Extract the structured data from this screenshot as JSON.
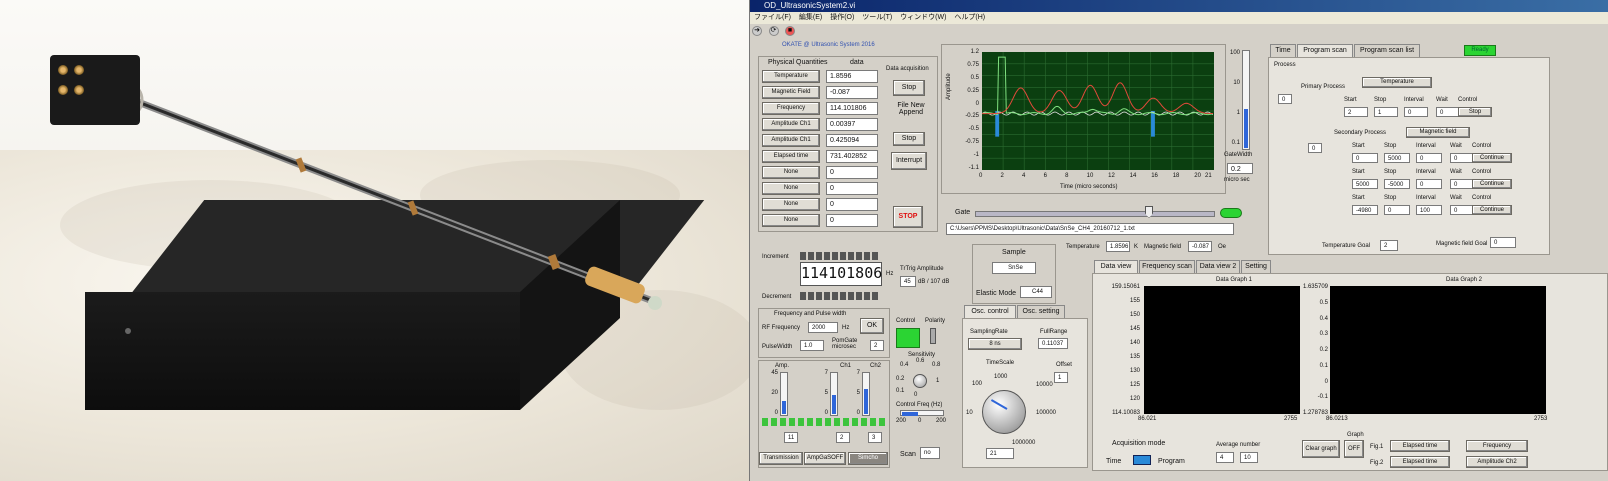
{
  "window": {
    "title": "OD_UltrasonicSystem2.vi",
    "menu": [
      "ファイル(F)",
      "編集(E)",
      "操作(O)",
      "ツール(T)",
      "ウィンドウ(W)",
      "ヘルプ(H)"
    ],
    "banner": "OKATE @ Ultrasonic System 2016",
    "status": "Ready"
  },
  "physical": {
    "header_qty": "Physical Quantities",
    "header_data": "data",
    "rows": [
      {
        "label": "Temperature",
        "value": "1.8596"
      },
      {
        "label": "Magnetic Field",
        "value": "-0.087"
      },
      {
        "label": "Frequency",
        "value": "114.101806"
      },
      {
        "label": "Amplitude Ch1",
        "value": "0.00397"
      },
      {
        "label": "Amplitude Ch1",
        "value": "0.425094"
      },
      {
        "label": "Elapsed time",
        "value": "731.402852"
      },
      {
        "label": "None",
        "value": "0"
      },
      {
        "label": "None",
        "value": "0"
      },
      {
        "label": "None",
        "value": "0"
      },
      {
        "label": "None",
        "value": "0"
      }
    ]
  },
  "acq": {
    "data_acq": "Data acquisition",
    "stop": "Stop",
    "file_append": "File New Append",
    "stop2": "Stop",
    "interrupt": "Interrupt",
    "stop_red": "STOP"
  },
  "osc": {
    "y_ticks": [
      "1.2",
      "0.75",
      "0.5",
      "0.25",
      "0",
      "-0.25",
      "-0.5",
      "-0.75",
      "-1",
      "-1.1"
    ],
    "x_ticks": [
      "0",
      "2",
      "4",
      "6",
      "8",
      "10",
      "12",
      "14",
      "16",
      "18",
      "20",
      "21"
    ],
    "xlabel": "Time (micro seconds)",
    "ylabel": "Amplitude",
    "gatewidth_label": "GateWidth",
    "gatewidth_value": "0.2",
    "gatewidth_unit": "micro sec",
    "bar_ticks": [
      "100",
      "10",
      "1",
      "0.1"
    ],
    "gate_label": "Gate",
    "path": "C:\\Users\\PPMS\\Desktop\\Ultrasonic\\Data\\SnSe_CH4_20160712_1.txt"
  },
  "readout": {
    "temperature_label": "Temperature",
    "temperature": "1.8596",
    "temperature_unit": "K",
    "field_label": "Magnetic field",
    "field": "-0.087",
    "field_unit": "Oe"
  },
  "freq": {
    "increment": "Increment",
    "decrement": "Decrement",
    "display": "114101806",
    "unit": "Hz",
    "trig_label": "TrTrig Amplitude",
    "trig_value": "45",
    "trig_unit": "dB / 107 dB",
    "section_title": "Frequency and Pulse width",
    "rf_label": "RF Frequency",
    "rf_value": "2000",
    "rf_unit": "Hz",
    "ok": "OK",
    "pw_label": "PulseWidth",
    "pw_value": "1.0",
    "pgate_label": "PomGate microsec",
    "pgate_value": "2"
  },
  "sample": {
    "title": "Sample",
    "name": "SnSe",
    "elastic_label": "Elastic Mode",
    "elastic_value": "C44"
  },
  "control": {
    "control_label": "Control",
    "polarity_label": "Polarity",
    "sensitivity_label": "Sensitivity",
    "sens_ticks": [
      "0.4",
      "0.6",
      "0.8",
      "0.2",
      "1",
      "0.1",
      "0"
    ],
    "cfreq_label": "Control Freq (Hz)",
    "cfreq_ticks": [
      "200",
      "0",
      "200"
    ],
    "scan_label": "Scan",
    "scan_value": "no"
  },
  "amp": {
    "amp_label": "Amp.",
    "ch1_label": "Ch1",
    "ch2_label": "Ch2",
    "amp_ticks": [
      "45",
      "20",
      "0"
    ],
    "ch_ticks": [
      "7",
      "5",
      "0"
    ],
    "amp_value": "11",
    "ch1_value": "2",
    "ch2_value": "3",
    "amp_level": 0.3,
    "ch1_level": 0.45,
    "ch2_level": 0.6,
    "b1": "Transmission",
    "b2": "AmpGaSOFF",
    "b3": "Simcho"
  },
  "osc_tabs": {
    "tab1": "Osc. control",
    "tab2": "Osc. setting",
    "sampling_label": "SamplingRate",
    "sampling_value": "8 ns",
    "fullrange_label": "FullRange",
    "fullrange_value": "0.11037",
    "timescale_label": "TimeScale",
    "ts_ticks": [
      "100",
      "1000",
      "10000",
      "1000000",
      "10",
      "100000"
    ],
    "offset_label": "Offset",
    "offset_value": "1",
    "timescale_value": "21"
  },
  "acq_mode": {
    "label": "Acquisition mode",
    "time": "Time",
    "program": "Program",
    "avg_label": "Average number",
    "avg_a": "4",
    "avg_b": "10"
  },
  "right_tabs": {
    "tab1": "Time",
    "tab2": "Program scan",
    "tab3": "Program scan list",
    "process": "Process",
    "primary_label": "Primary Process",
    "primary_value": "Temperature",
    "secondary_label": "Secondary Process",
    "secondary_value": "Magnetic field",
    "col_start": "Start",
    "col_stop": "Stop",
    "col_interval": "Interval",
    "col_wait": "Wait",
    "col_control": "Control",
    "p_idx": "0",
    "p_row": [
      "2",
      "1",
      "0",
      "0",
      "Stop"
    ],
    "s_idx": "0",
    "s_rows": [
      [
        "0",
        "5000",
        "0",
        "0",
        "Continue"
      ],
      [
        "5000",
        "-5000",
        "0",
        "0",
        "Continue"
      ],
      [
        "-4980",
        "0",
        "100",
        "0",
        "Continue"
      ]
    ],
    "tgoal_label": "Temperature Goal",
    "tgoal_value": "2",
    "mgoal_label": "Magnetic field Goal",
    "mgoal_value": "0"
  },
  "data_tabs": {
    "tab1": "Data view",
    "tab2": "Frequency scan",
    "tab3": "Data view 2",
    "tab4": "Setting",
    "g1_title": "Data Graph 1",
    "g1_y": [
      "159.15061",
      "155",
      "150",
      "145",
      "140",
      "135",
      "130",
      "125",
      "120",
      "114.10083"
    ],
    "g1_x": [
      "86.021",
      "2755"
    ],
    "g2_title": "Data Graph 2",
    "g2_y": [
      "1.635709",
      "0.5",
      "0.4",
      "0.3",
      "0.2",
      "0.1",
      "0",
      "-0.1",
      "1.278783"
    ],
    "g2_x": [
      "86.0213",
      "2753"
    ],
    "clear": "Clear graph",
    "graph_label": "Graph",
    "graph_state": "OFF",
    "fig1": "Fig.1",
    "fig2": "Fig.2",
    "fig1_x": "Elapsed time",
    "fig1_y": "Frequency",
    "fig2_x": "Elapsed time",
    "fig2_y": "Amplitude Ch2"
  },
  "colors": {
    "plot_bg": "#0b3f10",
    "trace_red": "#e04a3a",
    "trace_green": "#7fe07f",
    "trace_white": "#e0e0e0",
    "gate_blue": "#2a8ad8"
  }
}
